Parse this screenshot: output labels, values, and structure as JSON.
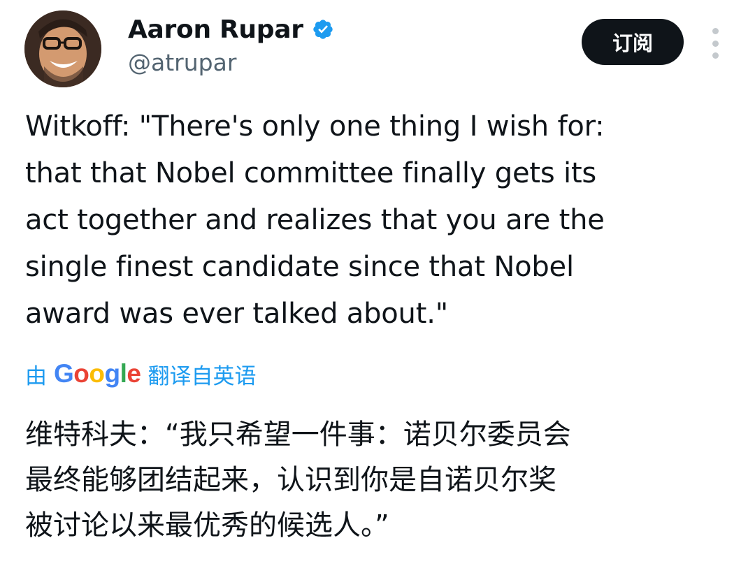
{
  "author": {
    "display_name": "Aaron Rupar",
    "handle": "@atrupar",
    "verified": true,
    "verified_icon": "verified-badge-icon",
    "avatar_icon": "avatar-photo"
  },
  "header": {
    "subscribe_label": "订阅",
    "more_icon": "more-vertical-icon"
  },
  "tweet": {
    "lines": [
      "Witkoff: \"There's only one thing I wish for:",
      "that that Nobel committee finally gets its",
      "act together and realizes that you are the",
      "single finest candidate since that Nobel",
      "award was ever talked about.\""
    ]
  },
  "translation": {
    "prefix": "由",
    "google_letters": [
      "G",
      "o",
      "o",
      "g",
      "l",
      "e"
    ],
    "suffix": "翻译自英语",
    "lines": [
      "维特科夫：“我只希望一件事：诺贝尔委员会",
      "最终能够团结起来，认识到你是自诺贝尔奖",
      "被讨论以来最优秀的候选人。”"
    ]
  },
  "colors": {
    "link_blue": "#1d9bf0",
    "text_primary": "#0f1419",
    "text_secondary": "#536471",
    "verified_blue": "#1d9bf0"
  }
}
